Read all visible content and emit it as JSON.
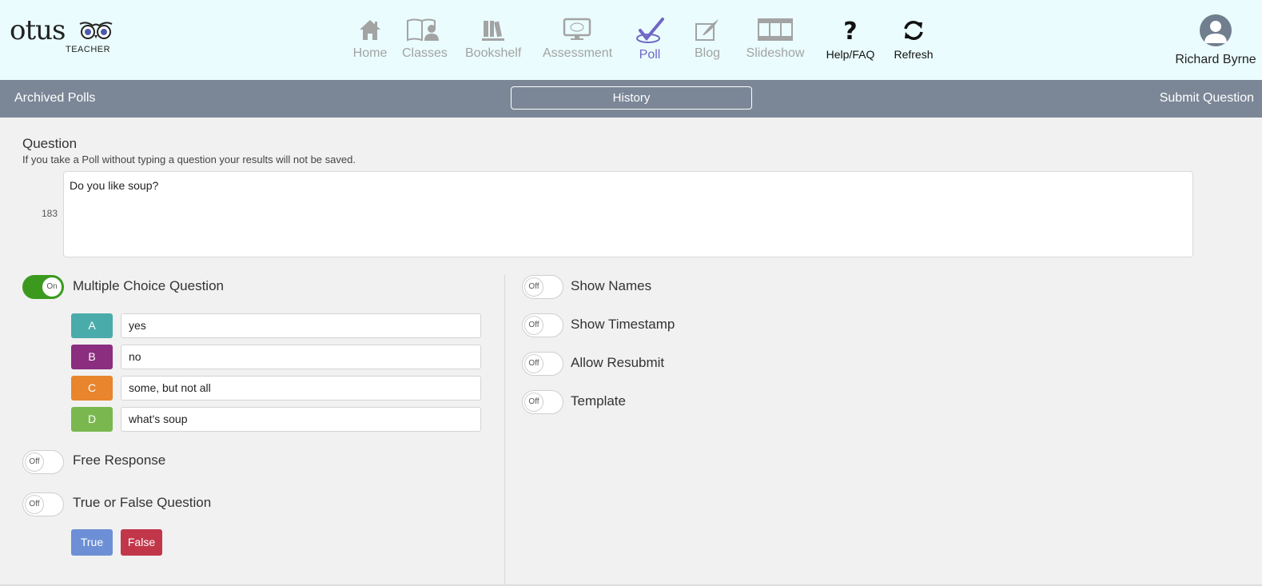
{
  "brand": {
    "name": "otus",
    "sub": "TEACHER"
  },
  "nav": [
    {
      "label": "Home",
      "icon": "home-icon"
    },
    {
      "label": "Classes",
      "icon": "classes-icon"
    },
    {
      "label": "Bookshelf",
      "icon": "bookshelf-icon"
    },
    {
      "label": "Assessment",
      "icon": "assessment-icon"
    },
    {
      "label": "Poll",
      "icon": "poll-check-icon",
      "active": true
    },
    {
      "label": "Blog",
      "icon": "blog-icon"
    },
    {
      "label": "Slideshow",
      "icon": "slideshow-icon"
    },
    {
      "label": "Help/FAQ",
      "icon": "question-icon"
    },
    {
      "label": "Refresh",
      "icon": "refresh-icon"
    }
  ],
  "user": {
    "name": "Richard Byrne"
  },
  "actionbar": {
    "archived": "Archived Polls",
    "history": "History",
    "submit": "Submit Question"
  },
  "question": {
    "title": "Question",
    "note": "If you take a Poll without typing a question your results will not be saved.",
    "count": "183",
    "text": "Do you like soup?"
  },
  "multiple_choice": {
    "label": "Multiple Choice Question",
    "state": "On",
    "choices": [
      {
        "letter": "A",
        "value": "yes",
        "color": "#4aabab"
      },
      {
        "letter": "B",
        "value": "no",
        "color": "#8b2e7f"
      },
      {
        "letter": "C",
        "value": "some, but not all",
        "color": "#e8852d"
      },
      {
        "letter": "D",
        "value": "what's soup",
        "color": "#7ab84f"
      }
    ]
  },
  "free_response": {
    "label": "Free Response",
    "state": "Off"
  },
  "true_false": {
    "label": "True or False Question",
    "state": "Off",
    "true_label": "True",
    "false_label": "False",
    "true_color": "#6c8fd6",
    "false_color": "#c2364a"
  },
  "settings": [
    {
      "label": "Show Names",
      "state": "Off"
    },
    {
      "label": "Show Timestamp",
      "state": "Off"
    },
    {
      "label": "Allow Resubmit",
      "state": "Off"
    },
    {
      "label": "Template",
      "state": "Off"
    }
  ]
}
